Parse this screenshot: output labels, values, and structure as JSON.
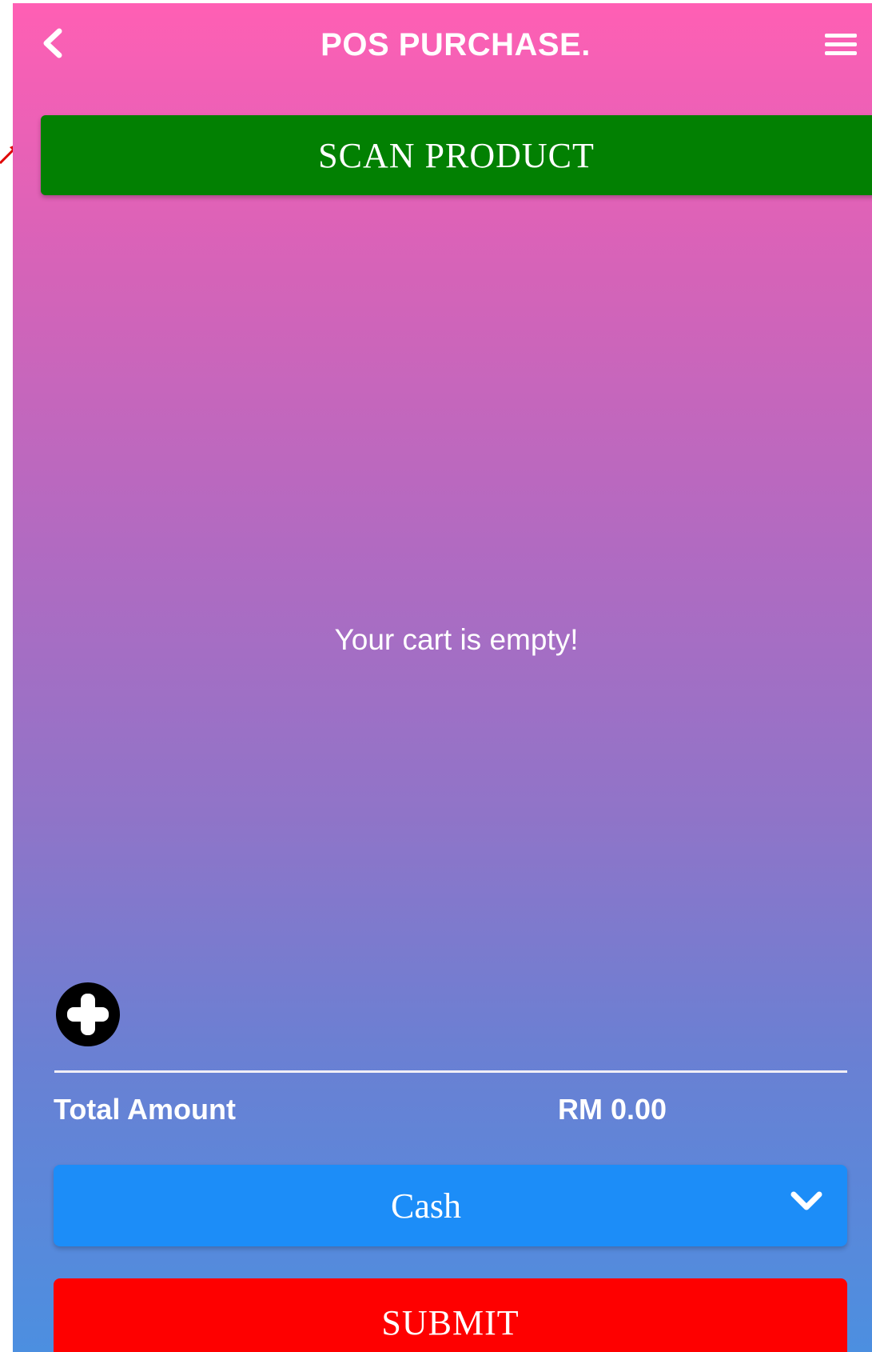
{
  "header": {
    "title": "POS PURCHASE.",
    "back_icon": "chevron-left-icon",
    "menu_icon": "hamburger-menu-icon"
  },
  "scan": {
    "label": "SCAN PRODUCT"
  },
  "cart": {
    "empty_message": "Your cart is empty!",
    "add_icon": "plus-circle-icon"
  },
  "total": {
    "label": "Total Amount",
    "value": "RM 0.00"
  },
  "payment": {
    "selected": "Cash",
    "dropdown_icon": "chevron-down-icon"
  },
  "submit": {
    "label": "SUBMIT"
  },
  "colors": {
    "gradient_top": "#ff5fb4",
    "gradient_bottom": "#4c8fe0",
    "scan_button": "#028002",
    "payment_select": "#1c8df8",
    "submit_button": "#fe0000",
    "annotation_arrow": "#e00000"
  }
}
